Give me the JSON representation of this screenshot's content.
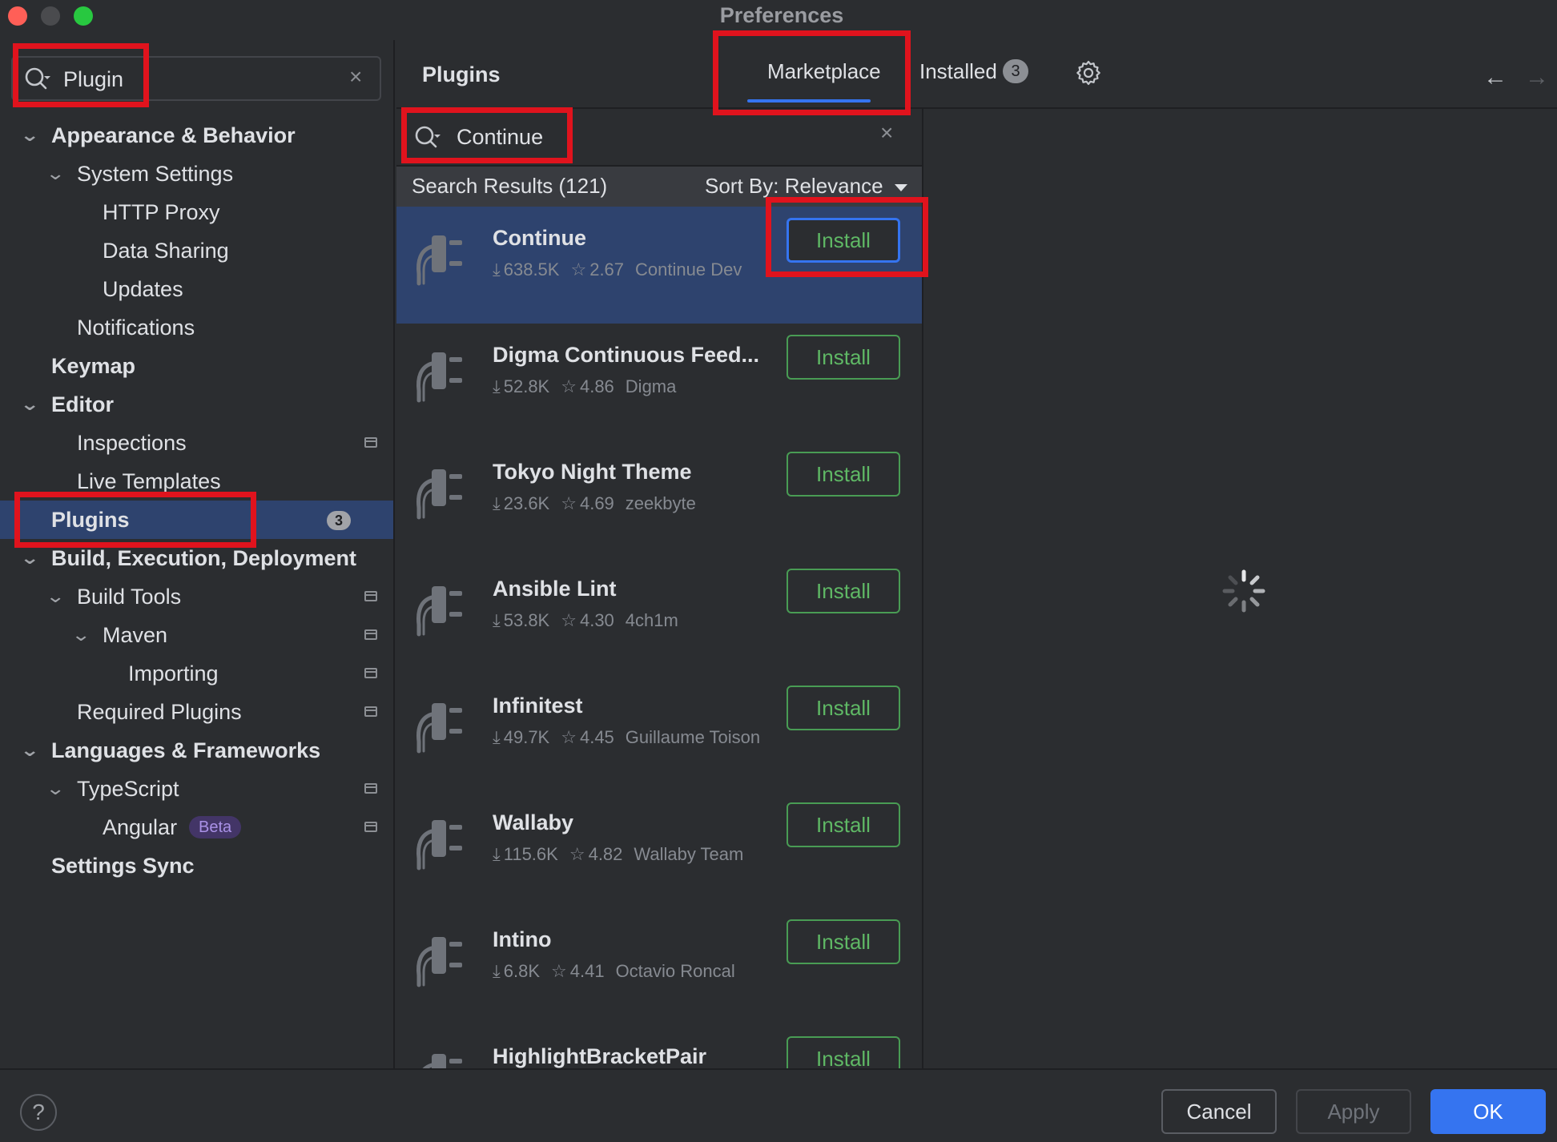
{
  "window": {
    "title": "Preferences"
  },
  "sidebar": {
    "search_value": "Plugin",
    "items": [
      {
        "label": "Appearance & Behavior"
      },
      {
        "label": "System Settings"
      },
      {
        "label": "HTTP Proxy"
      },
      {
        "label": "Data Sharing"
      },
      {
        "label": "Updates"
      },
      {
        "label": "Notifications"
      },
      {
        "label": "Keymap"
      },
      {
        "label": "Editor"
      },
      {
        "label": "Inspections"
      },
      {
        "label": "Live Templates"
      },
      {
        "label": "Plugins",
        "badge": "3"
      },
      {
        "label": "Build, Execution, Deployment"
      },
      {
        "label": "Build Tools"
      },
      {
        "label": "Maven"
      },
      {
        "label": "Importing"
      },
      {
        "label": "Required Plugins"
      },
      {
        "label": "Languages & Frameworks"
      },
      {
        "label": "TypeScript"
      },
      {
        "label": "Angular",
        "badge": "Beta"
      },
      {
        "label": "Settings Sync"
      }
    ]
  },
  "header": {
    "title": "Plugins",
    "tabs": [
      {
        "label": "Marketplace"
      },
      {
        "label": "Installed",
        "badge": "3"
      }
    ]
  },
  "marketplace": {
    "search_value": "Continue",
    "results_label": "Search Results (121)",
    "sort_label": "Sort By: Relevance",
    "plugins": [
      {
        "name": "Continue",
        "downloads": "638.5K",
        "rating": "2.67",
        "vendor": "Continue Dev",
        "action": "Install"
      },
      {
        "name": "Digma Continuous Feed...",
        "downloads": "52.8K",
        "rating": "4.86",
        "vendor": "Digma",
        "action": "Install"
      },
      {
        "name": "Tokyo Night Theme",
        "downloads": "23.6K",
        "rating": "4.69",
        "vendor": "zeekbyte",
        "action": "Install"
      },
      {
        "name": "Ansible Lint",
        "downloads": "53.8K",
        "rating": "4.30",
        "vendor": "4ch1m",
        "action": "Install"
      },
      {
        "name": "Infinitest",
        "downloads": "49.7K",
        "rating": "4.45",
        "vendor": "Guillaume Toison",
        "action": "Install"
      },
      {
        "name": "Wallaby",
        "downloads": "115.6K",
        "rating": "4.82",
        "vendor": "Wallaby Team",
        "action": "Install"
      },
      {
        "name": "Intino",
        "downloads": "6.8K",
        "rating": "4.41",
        "vendor": "Octavio Roncal",
        "action": "Install"
      },
      {
        "name": "HighlightBracketPair",
        "downloads": "",
        "rating": "",
        "vendor": "",
        "action": "Install"
      }
    ]
  },
  "footer": {
    "help": "?",
    "cancel": "Cancel",
    "apply": "Apply",
    "ok": "OK"
  },
  "colors": {
    "background": "#2b2d30",
    "selection": "#2e436e",
    "accent": "#3574f0",
    "install_green": "#5fb865",
    "annotation_red": "#e0131d"
  }
}
